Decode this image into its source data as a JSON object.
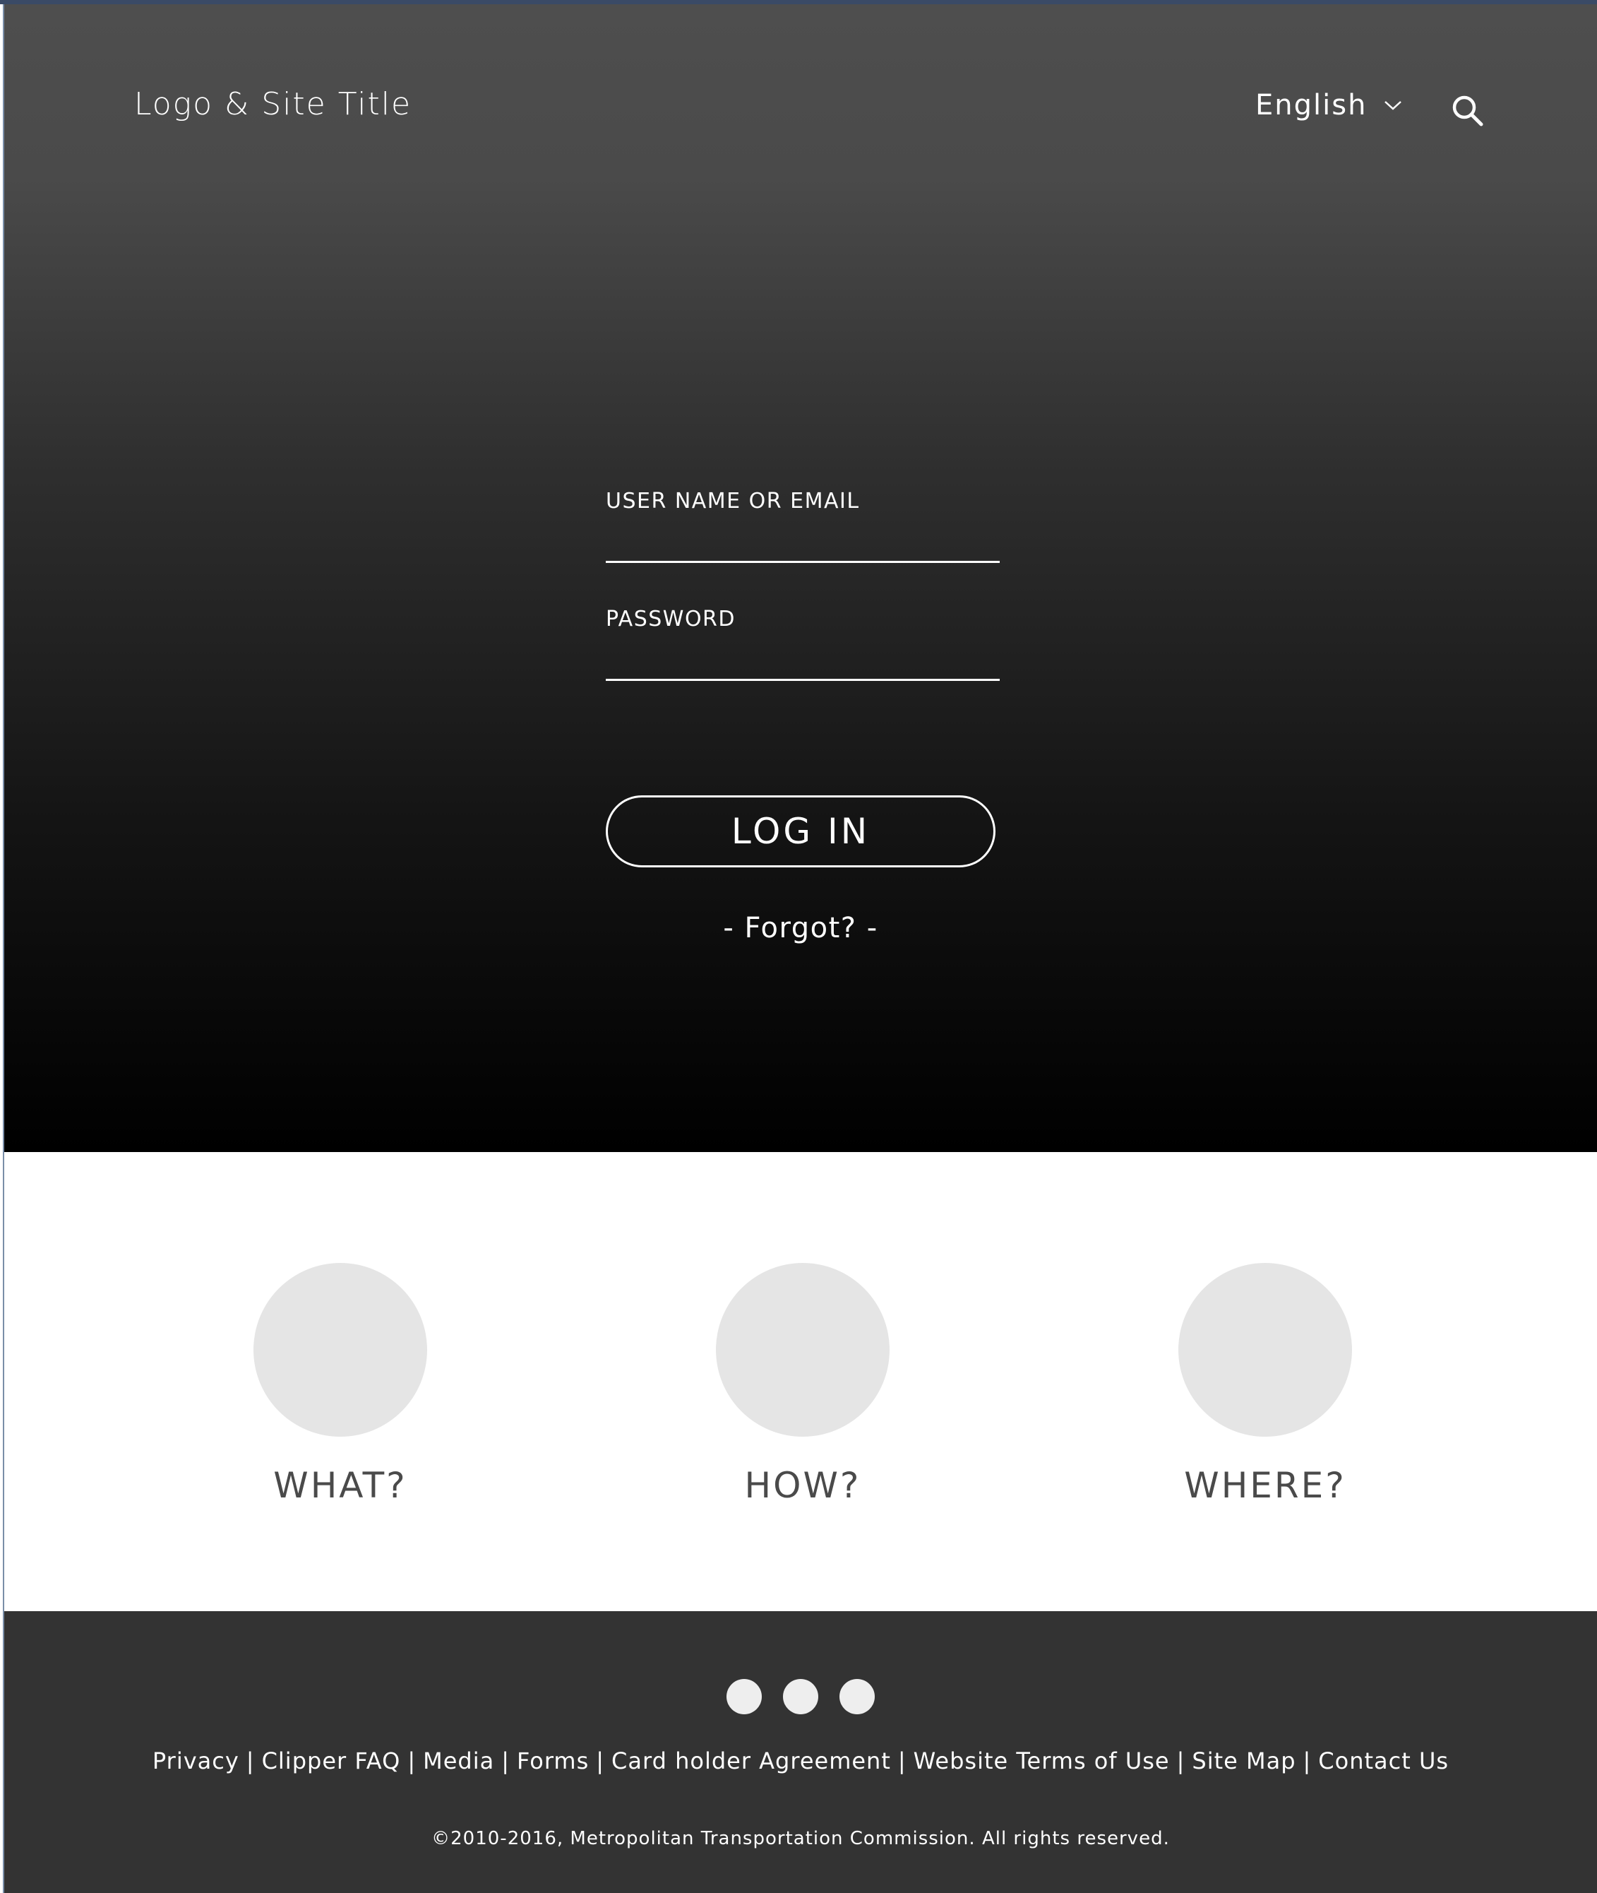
{
  "header": {
    "site_title": "Logo & Site Title",
    "language": "English"
  },
  "login": {
    "username_label": "USER NAME OR EMAIL",
    "username_value": "",
    "password_label": "PASSWORD",
    "password_value": "",
    "login_button": "LOG IN",
    "forgot": "- Forgot? -"
  },
  "features": [
    {
      "label": "WHAT?"
    },
    {
      "label": "HOW?"
    },
    {
      "label": "WHERE?"
    }
  ],
  "footer": {
    "links": [
      "Privacy",
      "Clipper FAQ",
      "Media",
      "Forms",
      "Card holder Agreement",
      "Website Terms of Use",
      "Site Map",
      "Contact Us"
    ],
    "separator": "|",
    "copyright": "©2010-2016, Metropolitan Transportation Commission. All rights reserved."
  },
  "colors": {
    "hero_top": "#4e4e4e",
    "hero_bottom": "#000000",
    "feature_circle": "#e5e5e5",
    "footer_bg": "#333333",
    "social_dot": "#eeeeee"
  },
  "icons": {
    "search": "search-icon",
    "language_dropdown": "chevron-down-icon"
  }
}
